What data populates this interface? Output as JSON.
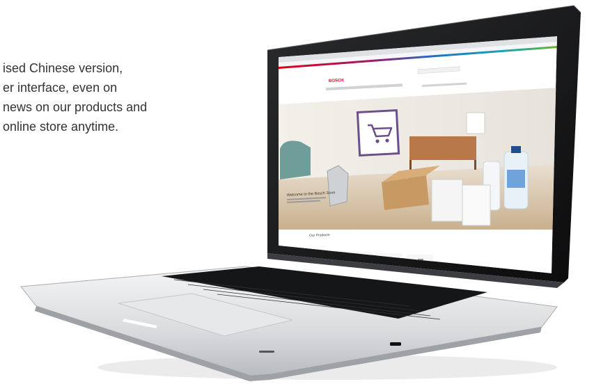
{
  "text_block": {
    "lines": [
      "ised Chinese version,",
      "er interface, even on",
      "news on our products and",
      "online store anytime."
    ]
  },
  "screen": {
    "logo_text": "BOSCH",
    "hero_welcome": "Welcome to the Bosch Store",
    "section_title": "Our Products",
    "colors": {
      "brand_red": "#e2001a",
      "cart_purple": "#6b4f8a"
    }
  }
}
